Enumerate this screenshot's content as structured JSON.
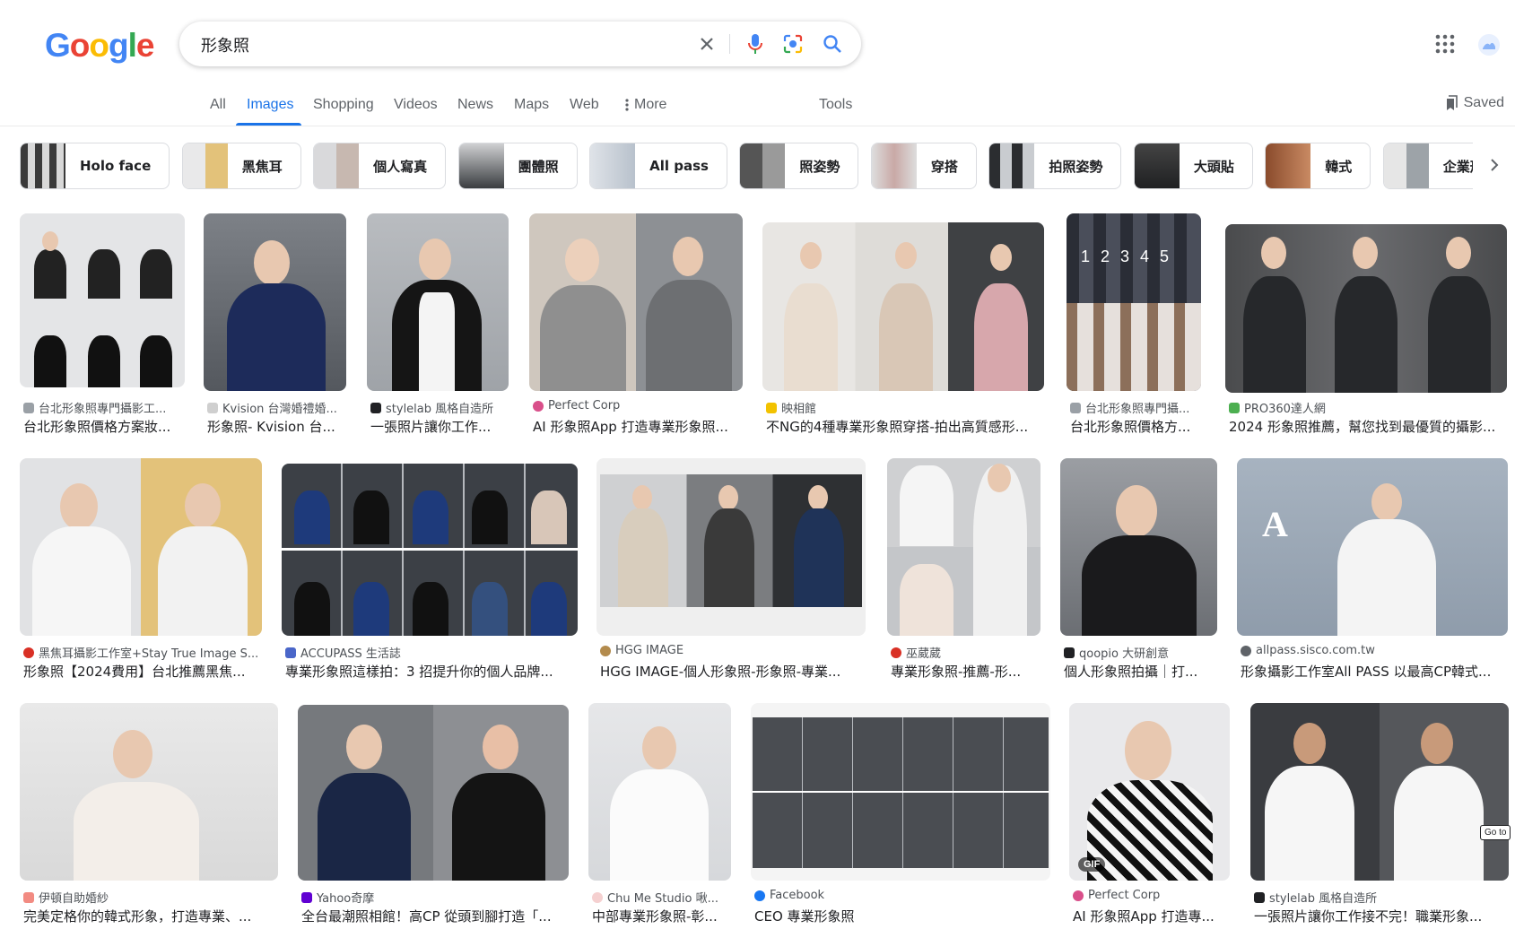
{
  "search": {
    "query": "形象照"
  },
  "tabs": [
    "All",
    "Images",
    "Shopping",
    "Videos",
    "News",
    "Maps",
    "Web",
    "More",
    "Tools"
  ],
  "saved_label": "Saved",
  "chips": [
    "Holo face",
    "黑焦耳",
    "個人寫真",
    "團體照",
    "All pass",
    "照姿勢",
    "穿搭",
    "拍照姿勢",
    "大頭貼",
    "韓式",
    "企業形象"
  ],
  "results": [
    {
      "source": "台北形象照專門攝影工...",
      "title": "台北形象照價格方案妝..."
    },
    {
      "source": "Kvision 台灣婚禮婚...",
      "title": "形象照- Kvision 台..."
    },
    {
      "source": "stylelab 風格自造所",
      "title": "一張照片讓你工作..."
    },
    {
      "source": "Perfect Corp",
      "title": "AI 形象照App 打造專業形象照..."
    },
    {
      "source": "映相館",
      "title": "不NG的4種專業形象照穿搭-拍出高質感形..."
    },
    {
      "source": "台北形象照專門攝...",
      "title": "台北形象照價格方..."
    },
    {
      "source": "PRO360達人網",
      "title": "2024 形象照推薦，幫您找到最優質的攝影..."
    },
    {
      "source": "黑焦耳攝影工作室+Stay True Image S...",
      "title": "形象照【2024費用】台北推薦黑焦..."
    },
    {
      "source": "ACCUPASS 生活誌",
      "title": "專業形象照這樣拍：3 招提升你的個人品牌..."
    },
    {
      "source": "HGG IMAGE",
      "title": "HGG IMAGE-個人形象照-形象照-專業..."
    },
    {
      "source": "巫葳葳",
      "title": "專業形象照-推薦-形..."
    },
    {
      "source": "qoopio 大研創意",
      "title": "個人形象照拍攝｜打..."
    },
    {
      "source": "allpass.sisco.com.tw",
      "title": "形象攝影工作室All PASS 以最高CP韓式..."
    },
    {
      "source": "伊頓自助婚紗",
      "title": "完美定格你的韓式形象，打造專業、..."
    },
    {
      "source": "Yahoo奇摩",
      "title": "全台最潮照相館！高CP 從頭到腳打造「..."
    },
    {
      "source": "Chu Me Studio 啾...",
      "title": "中部專業形象照-彰..."
    },
    {
      "source": "Facebook",
      "title": "CEO 專業形象照"
    },
    {
      "source": "Perfect Corp",
      "title": "AI 形象照App 打造專..."
    },
    {
      "source": "stylelab 風格自造所",
      "title": "一張照片讓你工作接不完！職業形象..."
    }
  ],
  "gif_label": "GIF",
  "goto_label": "Go to",
  "colors": {
    "accent": "#1a73e8",
    "text": "#202124",
    "muted": "#5f6368"
  }
}
